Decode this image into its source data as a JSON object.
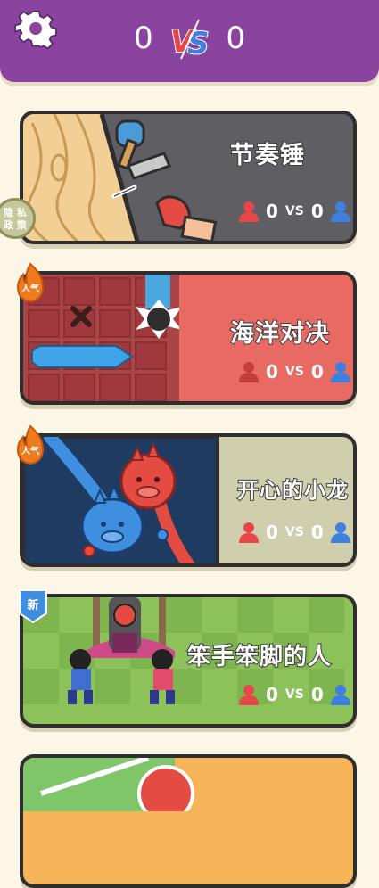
{
  "header": {
    "left_score": "0",
    "right_score": "0",
    "vs_label": "VS",
    "settings_icon": "gear-icon"
  },
  "privacy": {
    "line1": "隐 私",
    "line2": "政 策"
  },
  "games": [
    {
      "title": "节奏锤",
      "left_score": "0",
      "vs": "VS",
      "right_score": "0",
      "badge": ""
    },
    {
      "title": "海洋对决",
      "left_score": "0",
      "vs": "VS",
      "right_score": "0",
      "badge": "人气"
    },
    {
      "title": "开心的小龙",
      "left_score": "0",
      "vs": "VS",
      "right_score": "0",
      "badge": "人气"
    },
    {
      "title": "笨手笨脚的人",
      "left_score": "0",
      "vs": "VS",
      "right_score": "0",
      "badge": "新"
    }
  ],
  "colors": {
    "header": "#8a44a0",
    "background": "#fbf6e6",
    "player_red": "#e8474a",
    "player_blue": "#3f7fe0"
  }
}
